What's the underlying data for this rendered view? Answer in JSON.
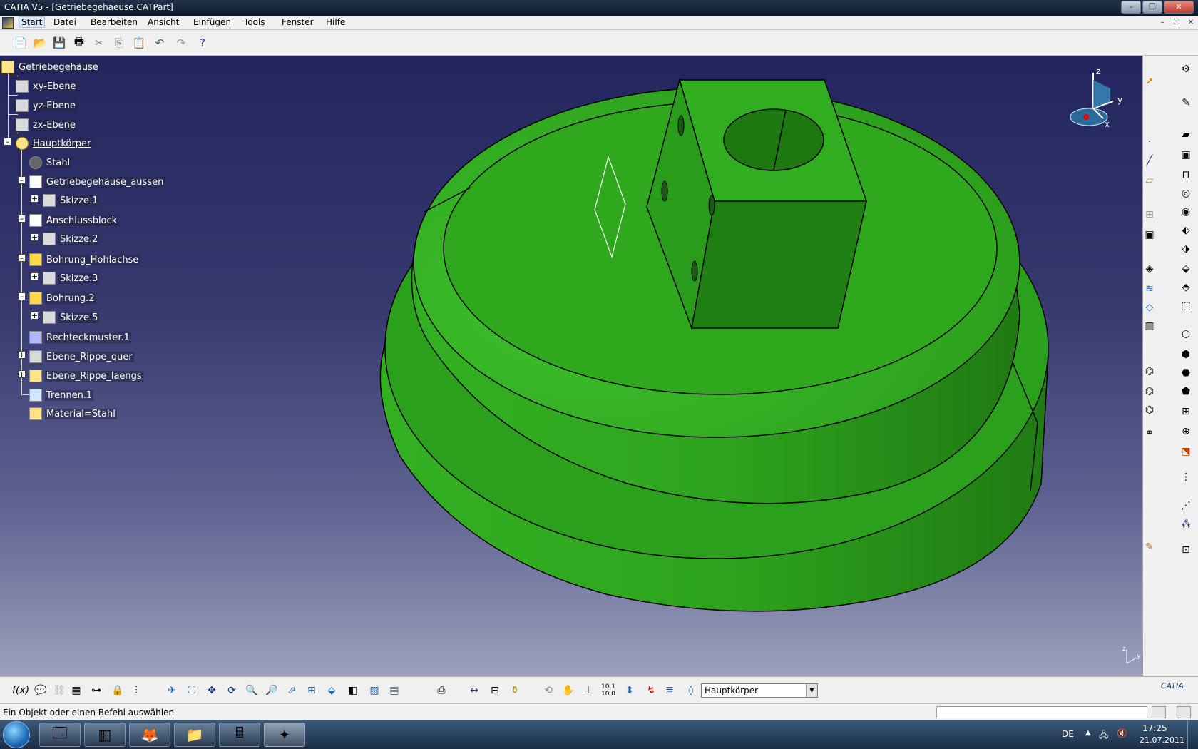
{
  "window": {
    "title": "CATIA V5 - [Getriebegehaeuse.CATPart]"
  },
  "menubar": {
    "items": [
      "Start",
      "Datei",
      "Bearbeiten",
      "Ansicht",
      "Einfügen",
      "Tools",
      "Fenster",
      "Hilfe"
    ]
  },
  "tree": {
    "root": "Getriebegehäuse",
    "xy": "xy-Ebene",
    "yz": "yz-Ebene",
    "zx": "zx-Ebene",
    "body": "Hauptkörper",
    "stahl": "Stahl",
    "pad1": "Getriebegehäuse_aussen",
    "sk1": "Skizze.1",
    "pad2": "Anschlussblock",
    "sk2": "Skizze.2",
    "hole1": "Bohrung_Hohlachse",
    "sk3": "Skizze.3",
    "hole2": "Bohrung.2",
    "sk5": "Skizze.5",
    "pattern": "Rechteckmuster.1",
    "plane1": "Ebene_Rippe_quer",
    "plane2": "Ebene_Rippe_laengs",
    "split": "Trennen.1",
    "material": "Material=Stahl"
  },
  "compass": {
    "x": "x",
    "y": "y",
    "z": "z"
  },
  "bottombar": {
    "current_body": "Hauptkörper",
    "logo": "CATIA"
  },
  "status": {
    "message": "Ein Objekt oder einen Befehl auswählen"
  },
  "taskbar": {
    "lang": "DE",
    "time": "17:25",
    "date": "21.07.2011"
  },
  "colors": {
    "part_green": "#2fa81e",
    "background_top": "#23255e",
    "background_bottom": "#9aa0bc"
  }
}
